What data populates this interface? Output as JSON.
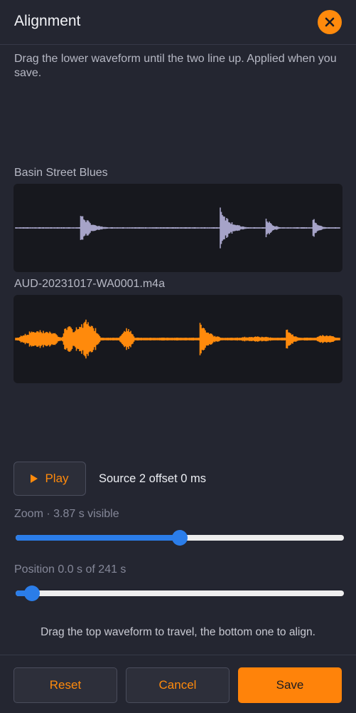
{
  "header": {
    "title": "Alignment",
    "close_icon": "close-icon"
  },
  "description": "Drag the lower waveform until the two line up. Applied when you save.",
  "tracks": [
    {
      "label": "Basin Street Blues",
      "color": "#a6a3c8"
    },
    {
      "label": "AUD-20231017-WA0001.m4a",
      "color": "#ff8a0c"
    }
  ],
  "playback": {
    "play_label": "Play",
    "offset_text": "Source 2 offset 0 ms"
  },
  "zoom": {
    "label": "Zoom · 3.87 s visible",
    "fraction": 0.5
  },
  "position": {
    "label": "Position 0.0 s of 241 s",
    "fraction": 0.05
  },
  "hint": "Drag the top waveform to travel, the bottom one to align.",
  "footer": {
    "reset_label": "Reset",
    "cancel_label": "Cancel",
    "save_label": "Save"
  },
  "colors": {
    "accent": "#ff8a0c",
    "slider": "#2b7de9",
    "background": "#242631"
  }
}
